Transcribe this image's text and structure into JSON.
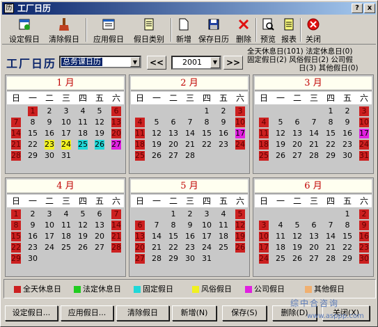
{
  "window": {
    "title": "工厂日历",
    "close_label": "x",
    "help_label": "?"
  },
  "toolbar": [
    {
      "label": "设定假日",
      "icon": "set-holiday-icon"
    },
    {
      "label": "清除假日",
      "icon": "clear-holiday-icon"
    },
    {
      "label": "应用假日",
      "icon": "apply-holiday-icon"
    },
    {
      "label": "假日类别",
      "icon": "holiday-category-icon"
    },
    {
      "label": "新增",
      "icon": "new-icon"
    },
    {
      "label": "保存日历",
      "icon": "save-icon"
    },
    {
      "label": "删除",
      "icon": "delete-icon"
    },
    {
      "label": "预览",
      "icon": "preview-icon"
    },
    {
      "label": "报表",
      "icon": "report-icon"
    },
    {
      "label": "关闭",
      "icon": "close-icon"
    }
  ],
  "controls": {
    "app_title": "工厂日历",
    "calendar_select": "总务课日历",
    "prev_label": "<<",
    "year": "2001",
    "next_label": ">>"
  },
  "stats": {
    "line1": "全天休息日(101) 法定休息日(0)",
    "line2": "固定假日(2) 风俗假日(2) 公司假",
    "line3": "日(3) 其他假日(0)"
  },
  "weekdays": [
    "日",
    "一",
    "二",
    "三",
    "四",
    "五",
    "六"
  ],
  "months": [
    {
      "title": "1  月",
      "offset": 1,
      "days": 31
    },
    {
      "title": "2  月",
      "offset": 4,
      "days": 28
    },
    {
      "title": "3  月",
      "offset": 4,
      "days": 31
    },
    {
      "title": "4  月",
      "offset": 0,
      "days": 30
    },
    {
      "title": "5  月",
      "offset": 2,
      "days": 31
    },
    {
      "title": "6  月",
      "offset": 5,
      "days": 30
    }
  ],
  "holiday_colors": {
    "full_rest": "#cc2020",
    "legal_rest": "#20cc20",
    "fixed": "#20d8d8",
    "custom": "#f0f020",
    "company": "#e020e0",
    "other": "#f0b070"
  },
  "special_days": [
    {
      "month": 0,
      "day": 1,
      "type": "full_rest"
    },
    {
      "month": 0,
      "day": 23,
      "type": "custom"
    },
    {
      "month": 0,
      "day": 24,
      "type": "custom"
    },
    {
      "month": 0,
      "day": 25,
      "type": "fixed"
    },
    {
      "month": 0,
      "day": 26,
      "type": "fixed"
    },
    {
      "month": 0,
      "day": 27,
      "type": "company"
    },
    {
      "month": 1,
      "day": 17,
      "type": "company"
    },
    {
      "month": 2,
      "day": 17,
      "type": "company"
    }
  ],
  "legend": [
    {
      "label": "全天休息日",
      "type": "full_rest"
    },
    {
      "label": "法定休息日",
      "type": "legal_rest"
    },
    {
      "label": "固定假日",
      "type": "fixed"
    },
    {
      "label": "风俗假日",
      "type": "custom"
    },
    {
      "label": "公司假日",
      "type": "company"
    },
    {
      "label": "其他假日",
      "type": "other"
    }
  ],
  "buttons": [
    {
      "label": "设定假日..."
    },
    {
      "label": "应用假日..."
    },
    {
      "label": "清除假日"
    },
    {
      "label": "新增(N)"
    },
    {
      "label": "保存(S)"
    },
    {
      "label": "删除(D)"
    },
    {
      "label": "关闭(X)"
    }
  ],
  "watermark": {
    "line1": "综中合咨询",
    "line2": "www.asppp.com"
  }
}
